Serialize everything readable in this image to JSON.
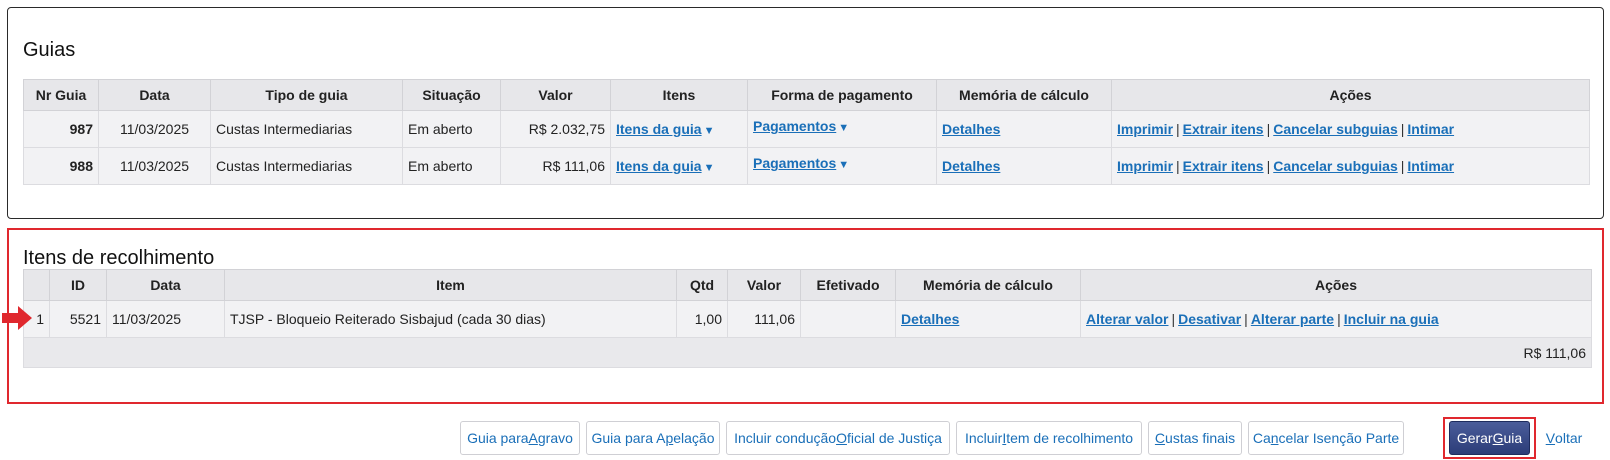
{
  "guias": {
    "title": "Guias",
    "headers": [
      "Nr Guia",
      "Data",
      "Tipo de guia",
      "Situação",
      "Valor",
      "Itens",
      "Forma de pagamento",
      "Memória de cálculo",
      "Ações"
    ],
    "rows": [
      {
        "nr": "987",
        "data": "11/03/2025",
        "tipo": "Custas Intermediarias",
        "situacao": "Em aberto",
        "valor": "R$ 2.032,75",
        "itens": "Itens da guia",
        "pagamento": "Pagamentos",
        "memoria": "Detalhes",
        "acoes": [
          "Imprimir",
          "Extrair itens",
          "Cancelar subguias",
          "Intimar"
        ]
      },
      {
        "nr": "988",
        "data": "11/03/2025",
        "tipo": "Custas Intermediarias",
        "situacao": "Em aberto",
        "valor": "R$ 111,06",
        "itens": "Itens da guia",
        "pagamento": "Pagamentos",
        "memoria": "Detalhes",
        "acoes": [
          "Imprimir",
          "Extrair itens",
          "Cancelar subguias",
          "Intimar"
        ]
      }
    ]
  },
  "itens": {
    "title": "Itens de recolhimento",
    "headers": [
      "",
      "ID",
      "Data",
      "Item",
      "Qtd",
      "Valor",
      "Efetivado",
      "Memória de cálculo",
      "Ações"
    ],
    "rows": [
      {
        "sel": "1",
        "id": "5521",
        "data": "11/03/2025",
        "item": "TJSP - Bloqueio Reiterado Sisbajud (cada 30 dias)",
        "qtd": "1,00",
        "valor": "111,06",
        "efetivado": "",
        "memoria": "Detalhes",
        "acoes": [
          "Alterar valor",
          "Desativar",
          "Alterar parte",
          "Incluir na guia"
        ]
      }
    ],
    "total": "R$ 111,06"
  },
  "icons": {
    "caret": "▼",
    "arrow": "red-right-arrow-icon"
  },
  "colors": {
    "link": "#1a6fb8",
    "highlight": "#e0282e",
    "primary_button": "#2c3d78"
  },
  "buttons": [
    {
      "pre": "Guia para ",
      "u": "A",
      "post": "gravo"
    },
    {
      "pre": "Guia para A",
      "u": "p",
      "post": "elação"
    },
    {
      "pre": "Incluir condução ",
      "u": "O",
      "post": "ficial de Justiça"
    },
    {
      "pre": "Incluir ",
      "u": "I",
      "post": "tem de recolhimento"
    },
    {
      "pre": "",
      "u": "C",
      "post": "ustas finais"
    },
    {
      "pre": "Ca",
      "u": "n",
      "post": "celar Isenção Parte"
    },
    {
      "pre": "Gerar ",
      "u": "G",
      "post": "uia"
    },
    {
      "pre": "",
      "u": "V",
      "post": "oltar"
    }
  ]
}
